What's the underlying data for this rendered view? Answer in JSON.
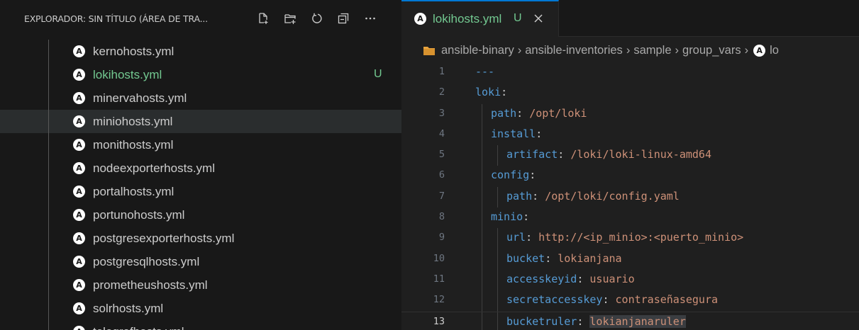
{
  "explorer": {
    "title": "EXPLORADOR: SIN TÍTULO (ÁREA DE TRA...",
    "actions": [
      "new-file-icon",
      "new-folder-icon",
      "refresh-icon",
      "collapse-all-icon",
      "more-icon"
    ],
    "files": [
      {
        "name": "kernohosts.yml"
      },
      {
        "name": "lokihosts.yml",
        "badge": "U",
        "untracked": true
      },
      {
        "name": "minervahosts.yml"
      },
      {
        "name": "miniohosts.yml",
        "selected": true
      },
      {
        "name": "monithosts.yml"
      },
      {
        "name": "nodeexporterhosts.yml"
      },
      {
        "name": "portalhosts.yml"
      },
      {
        "name": "portunohosts.yml"
      },
      {
        "name": "postgresexporterhosts.yml"
      },
      {
        "name": "postgresqlhosts.yml"
      },
      {
        "name": "prometheushosts.yml"
      },
      {
        "name": "solrhosts.yml"
      },
      {
        "name": "telegrafhosts.yml"
      }
    ]
  },
  "tab": {
    "label": "lokihosts.yml",
    "status": "U",
    "icon": "ansible-icon",
    "close_icon": "close-icon"
  },
  "breadcrumb": [
    "ansible-binary",
    "ansible-inventories",
    "sample",
    "group_vars",
    "lo"
  ],
  "code": [
    {
      "n": "1",
      "indent": 0,
      "key": "---",
      "sep": "",
      "value": ""
    },
    {
      "n": "2",
      "indent": 0,
      "key": "loki",
      "sep": ":",
      "value": ""
    },
    {
      "n": "3",
      "indent": 1,
      "key": "path",
      "sep": ": ",
      "value": "/opt/loki"
    },
    {
      "n": "4",
      "indent": 1,
      "key": "install",
      "sep": ":",
      "value": ""
    },
    {
      "n": "5",
      "indent": 2,
      "key": "artifact",
      "sep": ": ",
      "value": "/loki/loki-linux-amd64"
    },
    {
      "n": "6",
      "indent": 1,
      "key": "config",
      "sep": ":",
      "value": ""
    },
    {
      "n": "7",
      "indent": 2,
      "key": "path",
      "sep": ": ",
      "value": "/opt/loki/config.yaml"
    },
    {
      "n": "8",
      "indent": 1,
      "key": "minio",
      "sep": ":",
      "value": ""
    },
    {
      "n": "9",
      "indent": 2,
      "key": "url",
      "sep": ": ",
      "value": "http://<ip_minio>:<puerto_minio>"
    },
    {
      "n": "10",
      "indent": 2,
      "key": "bucket",
      "sep": ": ",
      "value": "lokianjana"
    },
    {
      "n": "11",
      "indent": 2,
      "key": "accesskeyid",
      "sep": ": ",
      "value": "usuario"
    },
    {
      "n": "12",
      "indent": 2,
      "key": "secretaccesskey",
      "sep": ": ",
      "value": "contraseñasegura"
    },
    {
      "n": "13",
      "indent": 2,
      "key": "bucketruler",
      "sep": ": ",
      "value": "lokianjanaruler",
      "current": true
    }
  ],
  "colors": {
    "key": "#569cd6",
    "string": "#ce9178",
    "untracked": "#73c991",
    "tab_accent": "#0078d4"
  }
}
